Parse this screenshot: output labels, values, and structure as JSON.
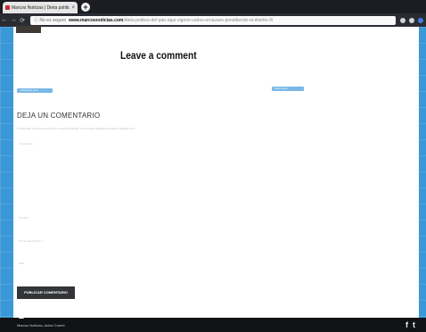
{
  "browser": {
    "tab_title": "Marcos Noticias | Dieta política del pan",
    "tab_close": "×",
    "new_tab": "+",
    "secure_text": "ⓘ No es seguro",
    "url_domain": "www.marcosnoticias.com",
    "url_path": "/dieta-politica-del-pan-aqui-vigorio-carlos-ernavaes-presidiendo-el-distrito-9/"
  },
  "page": {
    "heading": "Leave a comment",
    "pill_left": "« Previous post",
    "pill_right": "Next post »",
    "section_title": "DEJA UN COMENTARIO",
    "note": "Tu dirección de correo electrónico no será publicada. Los campos obligatorios están marcados con *",
    "labels": {
      "comment": "Comentario",
      "name": "Nombre *",
      "email": "Correo electrónico *",
      "web": "Web"
    },
    "submit": "PUBLICAR COMENTARIO"
  },
  "footer": {
    "copyright": "Marcos Noticias, Antes Cuentí",
    "social_facebook": "f",
    "social_twitter": "t"
  }
}
